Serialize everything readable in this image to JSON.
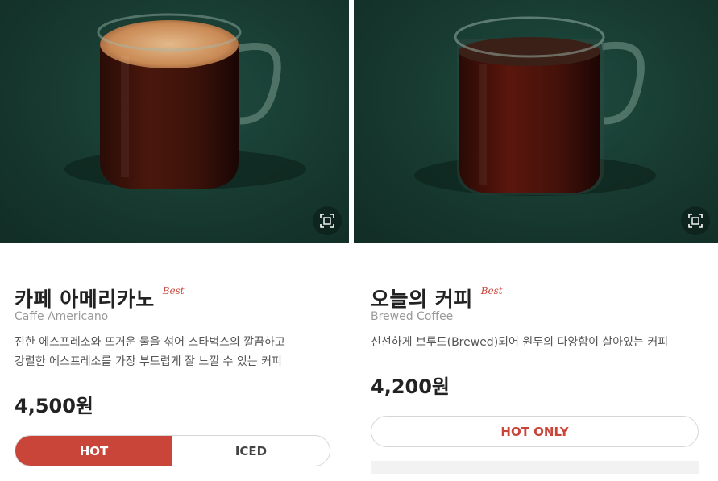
{
  "products": [
    {
      "name_ko": "카페 아메리카노",
      "badge": "Best",
      "name_en": "Caffe Americano",
      "description_lines": [
        "진한 에스프레소와 뜨거운 물을 섞어 스타벅스의 깔끔하고",
        "강렬한 에스프레소를 가장 부드럽게 잘 느낄 수 있는 커피"
      ],
      "price": "4,500원",
      "options": {
        "hot": "HOT",
        "iced": "ICED",
        "selected": "HOT"
      },
      "zoom_icon": "zoom-expand-icon"
    },
    {
      "name_ko": "오늘의 커피",
      "badge": "Best",
      "name_en": "Brewed Coffee",
      "description_lines": [
        "신선하게 브루드(Brewed)되어 원두의 다양함이 살아있는 커피"
      ],
      "price": "4,200원",
      "options": {
        "single": "HOT ONLY"
      },
      "zoom_icon": "zoom-expand-icon"
    }
  ],
  "colors": {
    "accent": "#c9453a",
    "photo_bg": "#17392f",
    "text_primary": "#222222",
    "text_secondary": "#9a9a9a"
  }
}
